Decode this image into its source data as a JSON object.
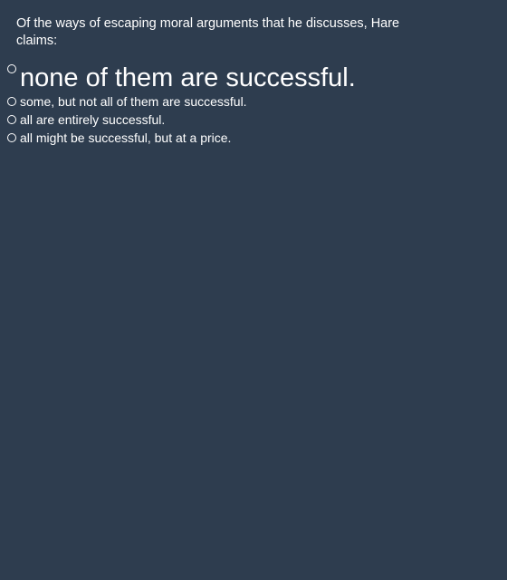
{
  "question": {
    "text": "Of the ways of escaping moral arguments that he discusses, Hare claims:"
  },
  "options": [
    {
      "label": "none of them are successful."
    },
    {
      "label": "some, but not all of them are successful."
    },
    {
      "label": "all are entirely successful."
    },
    {
      "label": "all might be successful, but at a price."
    }
  ]
}
